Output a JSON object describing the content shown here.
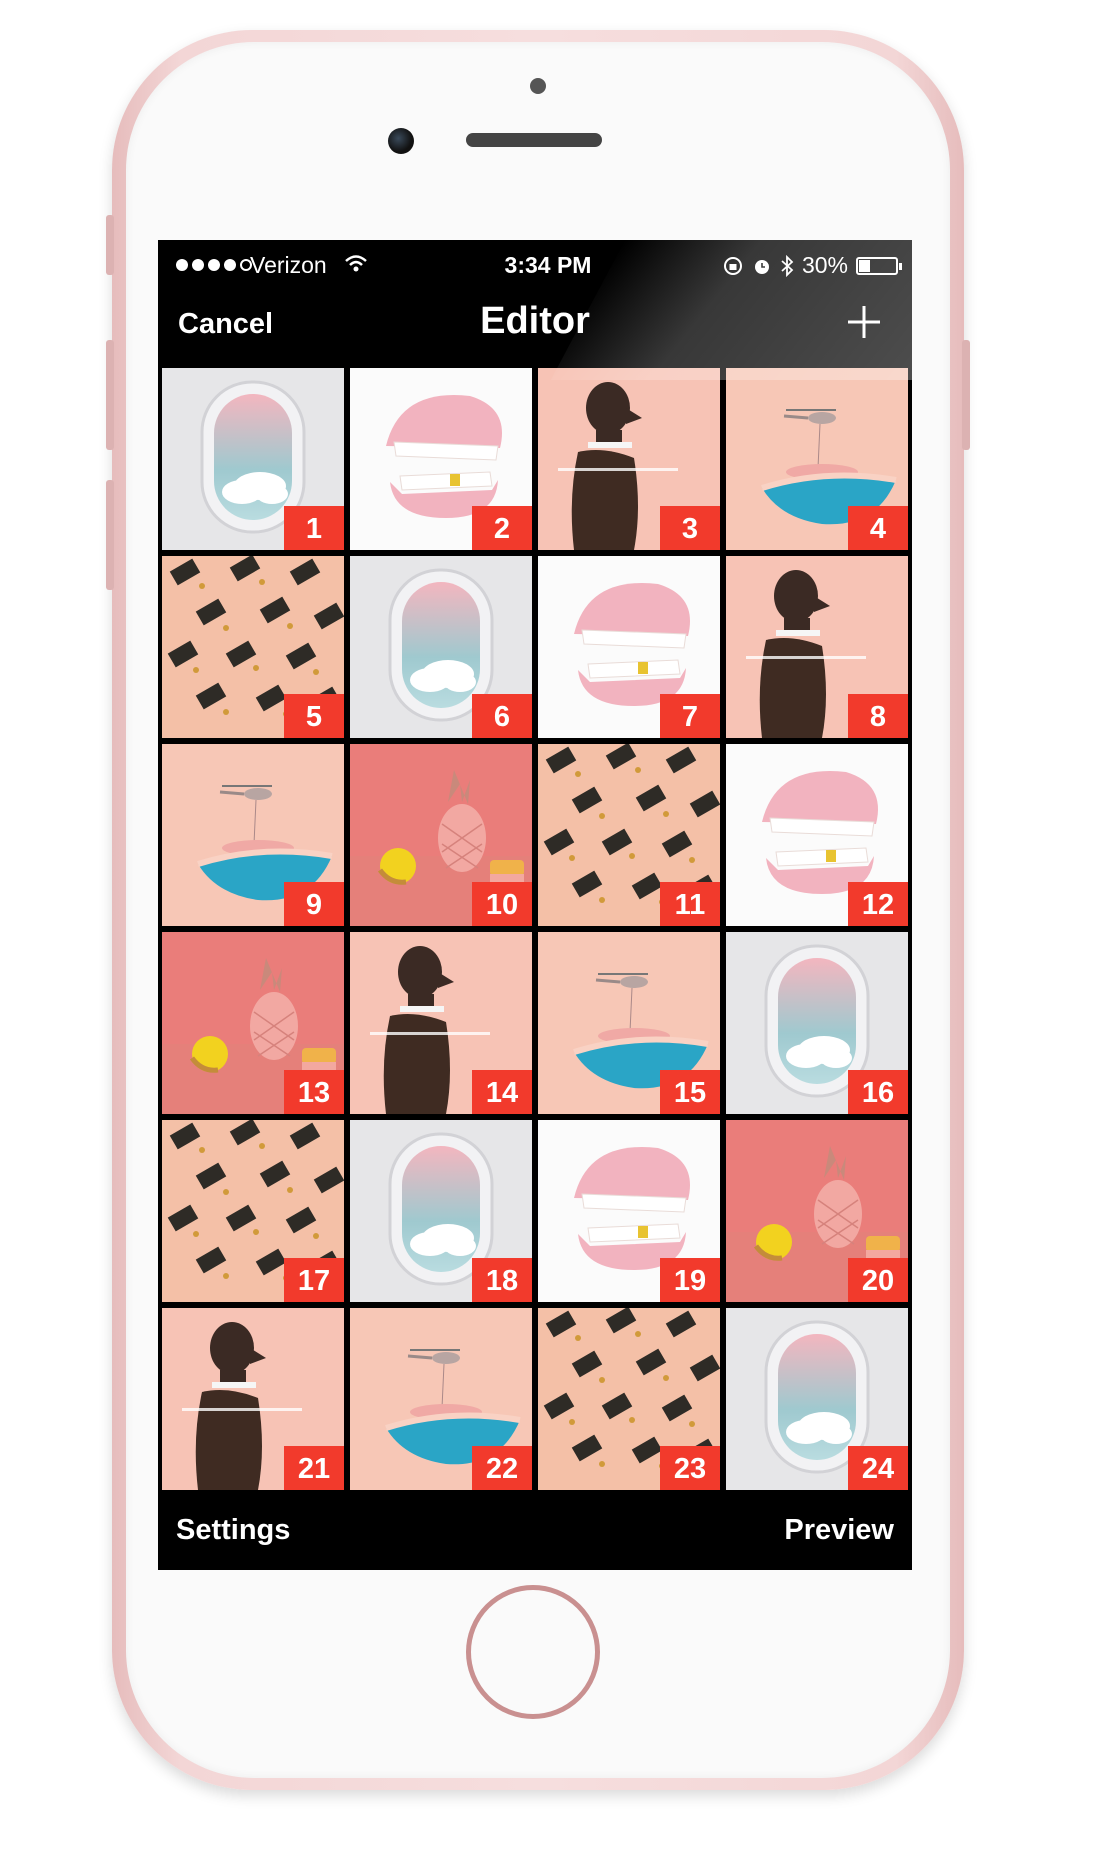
{
  "status_bar": {
    "signal_bars": "●●●●○",
    "carrier": "Verizon",
    "time": "3:34 PM",
    "battery": "30%",
    "battery_level": 0.3
  },
  "nav": {
    "cancel_label": "Cancel",
    "title": "Editor",
    "add_icon": "plus-icon"
  },
  "grid": {
    "items": [
      {
        "number": "1",
        "image": "airplane-window"
      },
      {
        "number": "2",
        "image": "teeth"
      },
      {
        "number": "3",
        "image": "figure"
      },
      {
        "number": "4",
        "image": "helicopter-pool"
      },
      {
        "number": "5",
        "image": "chairs-pattern"
      },
      {
        "number": "6",
        "image": "airplane-window"
      },
      {
        "number": "7",
        "image": "teeth"
      },
      {
        "number": "8",
        "image": "figure"
      },
      {
        "number": "9",
        "image": "helicopter-pool"
      },
      {
        "number": "10",
        "image": "pineapple"
      },
      {
        "number": "11",
        "image": "chairs-pattern"
      },
      {
        "number": "12",
        "image": "teeth"
      },
      {
        "number": "13",
        "image": "pineapple"
      },
      {
        "number": "14",
        "image": "figure"
      },
      {
        "number": "15",
        "image": "helicopter-pool"
      },
      {
        "number": "16",
        "image": "airplane-window"
      },
      {
        "number": "17",
        "image": "chairs-pattern"
      },
      {
        "number": "18",
        "image": "airplane-window"
      },
      {
        "number": "19",
        "image": "teeth"
      },
      {
        "number": "20",
        "image": "pineapple"
      },
      {
        "number": "21",
        "image": "figure"
      },
      {
        "number": "22",
        "image": "helicopter-pool"
      },
      {
        "number": "23",
        "image": "chairs-pattern"
      },
      {
        "number": "24",
        "image": "airplane-window"
      }
    ]
  },
  "bottom_bar": {
    "settings_label": "Settings",
    "preview_label": "Preview"
  },
  "colors": {
    "badge": "#f23a2c",
    "screen_bg": "#000000",
    "phone_body": "#f3d6d6"
  }
}
